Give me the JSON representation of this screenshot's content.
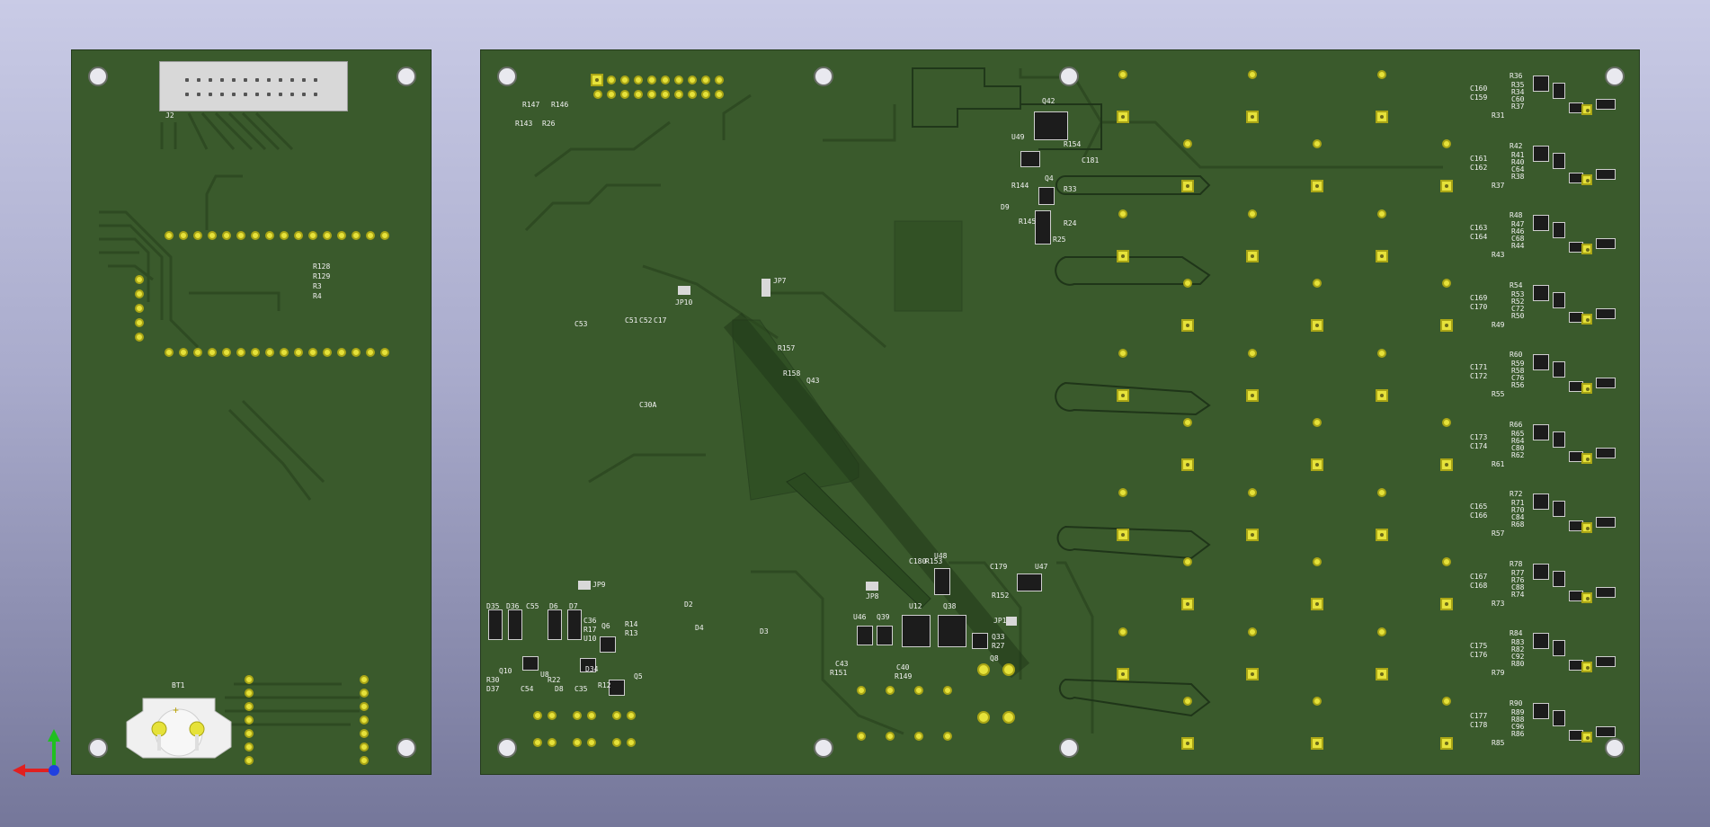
{
  "app": {
    "view": "3D Viewer",
    "background": "#c9cbe6"
  },
  "colors": {
    "soldermask": "#3a5a2c",
    "pad": "#e6e23a",
    "silkscreen": "#f2f2f2"
  },
  "axes_gizmo": {
    "x_color": "#e02020",
    "y_color": "#20c020",
    "z_color": "#2040e0",
    "icon": "axis-gizmo-icon"
  },
  "board_left": {
    "connector_label": "J2",
    "battery_label": "BT1",
    "resistor_labels": [
      "R128",
      "R129",
      "R3",
      "R4"
    ]
  },
  "board_right": {
    "top_labels": [
      "R147",
      "R146",
      "R143",
      "R26"
    ],
    "q42_labels": [
      "Q42",
      "U49",
      "R154",
      "C181",
      "Q4",
      "R33",
      "R144",
      "R24",
      "R145",
      "D9",
      "R25",
      "FT1"
    ],
    "mid_labels": [
      "JP10",
      "C53",
      "C51",
      "C52",
      "C17",
      "R157",
      "R158",
      "Q43",
      "JP7",
      "C30A"
    ],
    "bottom_left_labels": [
      "D35",
      "D36",
      "C55",
      "D6",
      "D7",
      "C36",
      "R17",
      "U10",
      "Q6",
      "R14",
      "R13",
      "Q5",
      "R30",
      "Q10",
      "D37",
      "C54",
      "U8",
      "R22",
      "D8",
      "C35",
      "D34",
      "R12",
      "JP9",
      "D2",
      "D4",
      "D3"
    ],
    "bottom_mid_labels": [
      "U46",
      "Q39",
      "U12",
      "Q38",
      "C43",
      "R151",
      "C40",
      "R149",
      "Q8",
      "Q33",
      "R27",
      "JP8",
      "C180",
      "R153",
      "C179",
      "U47",
      "R152",
      "JP1",
      "U48"
    ],
    "right_labels": [
      [
        "R36",
        "C160",
        "C159",
        "R35",
        "R34",
        "C60",
        "R37",
        "R31"
      ],
      [
        "R42",
        "C161",
        "C162",
        "R41",
        "R40",
        "C64",
        "R38",
        "R37"
      ],
      [
        "R48",
        "C163",
        "C164",
        "R47",
        "R46",
        "C68",
        "R44",
        "R43"
      ],
      [
        "R54",
        "C169",
        "C170",
        "R53",
        "R52",
        "C72",
        "R50",
        "R49"
      ],
      [
        "R60",
        "C171",
        "C172",
        "R59",
        "R58",
        "C76",
        "R56",
        "R55"
      ],
      [
        "R66",
        "C173",
        "C174",
        "R65",
        "R64",
        "C80",
        "R62",
        "R61"
      ],
      [
        "R72",
        "C165",
        "C166",
        "R71",
        "R70",
        "C84",
        "R68",
        "R57"
      ],
      [
        "R78",
        "C167",
        "C168",
        "R77",
        "R76",
        "C88",
        "R74",
        "R73"
      ],
      [
        "R84",
        "C175",
        "C176",
        "R83",
        "R82",
        "C92",
        "R80",
        "R79"
      ],
      [
        "R90",
        "C177",
        "C178",
        "R89",
        "R88",
        "C96",
        "R86",
        "R85"
      ]
    ]
  }
}
